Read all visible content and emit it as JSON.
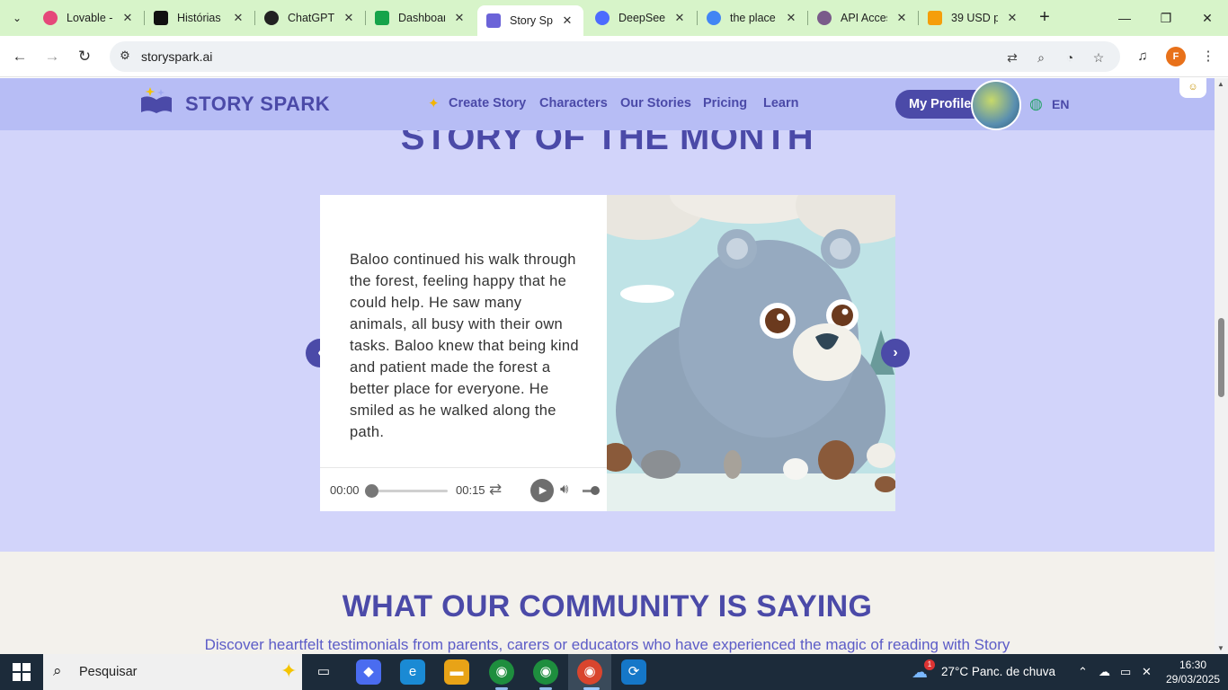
{
  "browser": {
    "tabs": [
      {
        "title": "Lovable -",
        "color": "#e5487a"
      },
      {
        "title": "Histórias",
        "color": "#111111"
      },
      {
        "title": "ChatGPT",
        "color": "#222222"
      },
      {
        "title": "Dashboar",
        "color": "#16a34a"
      },
      {
        "title": "Story Spa",
        "color": "#6b63d8",
        "active": true
      },
      {
        "title": "DeepSeek",
        "color": "#4d6bfe"
      },
      {
        "title": "the place",
        "color": "#4285f4"
      },
      {
        "title": "API Acces",
        "color": "#7a5b8a"
      },
      {
        "title": "39 USD p",
        "color": "#f59e0b"
      }
    ],
    "url": "storyspark.ai",
    "profile_initial": "F"
  },
  "site": {
    "brand": "STORY SPARK",
    "nav": [
      "Create Story",
      "Characters",
      "Our Stories",
      "Pricing",
      "Learn"
    ],
    "profile_button": "My Profile",
    "language": "EN",
    "accent": "#4b4aa8",
    "background": "#d2d4fa"
  },
  "story_of_month": {
    "heading": "STORY OF THE MONTH",
    "text": "Baloo continued his walk through the forest, feeling happy that he could help. He saw many animals, all busy with their own tasks. Baloo knew that being kind and patient made the forest a better place for everyone. He smiled as he walked along the path.",
    "audio": {
      "current": "00:00",
      "duration": "00:15",
      "progress": 0
    }
  },
  "community": {
    "heading": "WHAT OUR COMMUNITY IS SAYING",
    "subtitle": "Discover heartfelt testimonials from parents, carers or educators who have experienced the magic of reading with Story"
  },
  "taskbar": {
    "search_placeholder": "Pesquisar",
    "weather_badge": "1",
    "weather": "27°C  Panc. de chuva",
    "time": "16:30",
    "date": "29/03/2025"
  }
}
